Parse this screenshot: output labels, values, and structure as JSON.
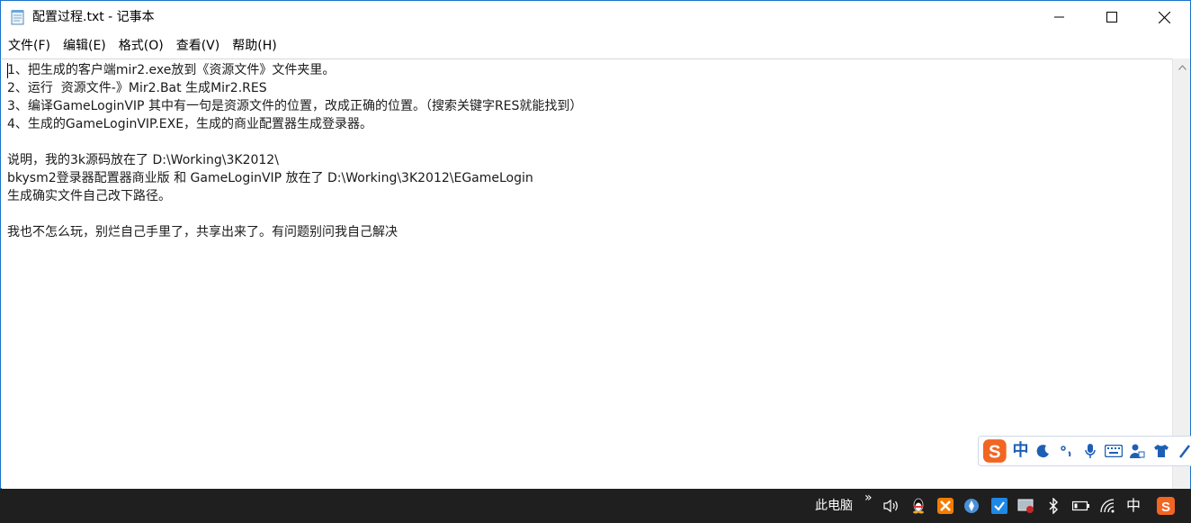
{
  "window": {
    "title": "配置过程.txt - 记事本"
  },
  "menu": [
    {
      "label": "文件(F)"
    },
    {
      "label": "编辑(E)"
    },
    {
      "label": "格式(O)"
    },
    {
      "label": "查看(V)"
    },
    {
      "label": "帮助(H)"
    }
  ],
  "editor": {
    "content": "1、把生成的客户端mir2.exe放到《资源文件》文件夹里。\n2、运行  资源文件-》Mir2.Bat 生成Mir2.RES\n3、编译GameLoginVIP 其中有一句是资源文件的位置，改成正确的位置。（搜索关键字RES就能找到）\n4、生成的GameLoginVIP.EXE，生成的商业配置器生成登录器。\n\n说明，我的3k源码放在了 D:\\Working\\3K2012\\\nbkysm2登录器配置器商业版 和 GameLoginVIP 放在了 D:\\Working\\3K2012\\EGameLogin\n生成确实文件自己改下路径。\n\n我也不怎么玩，别烂自己手里了，共享出来了。有问题别问我自己解决"
  },
  "ime": {
    "mode_label": "中",
    "icons": [
      "sogou-logo-icon",
      "moon-icon",
      "punctuation-icon",
      "microphone-icon",
      "keyboard-icon",
      "user-icon",
      "shirt-icon",
      "tools-icon"
    ]
  },
  "taskbar": {
    "location_label": "此电脑",
    "chevron": "»",
    "tray_icons": [
      "speaker-icon",
      "qq-penguin-icon",
      "xampp-icon",
      "app-blue-icon",
      "app-check-icon",
      "app-screen-icon",
      "bluetooth-icon",
      "battery-icon",
      "wifi-icon",
      "sogou-tray-icon"
    ],
    "input_indicator": "中"
  },
  "colors": {
    "window_border": "#1a73c8",
    "taskbar_bg": "#1f1f1f",
    "ime_blue": "#1e5fb4",
    "sogou_orange": "#f26522"
  }
}
